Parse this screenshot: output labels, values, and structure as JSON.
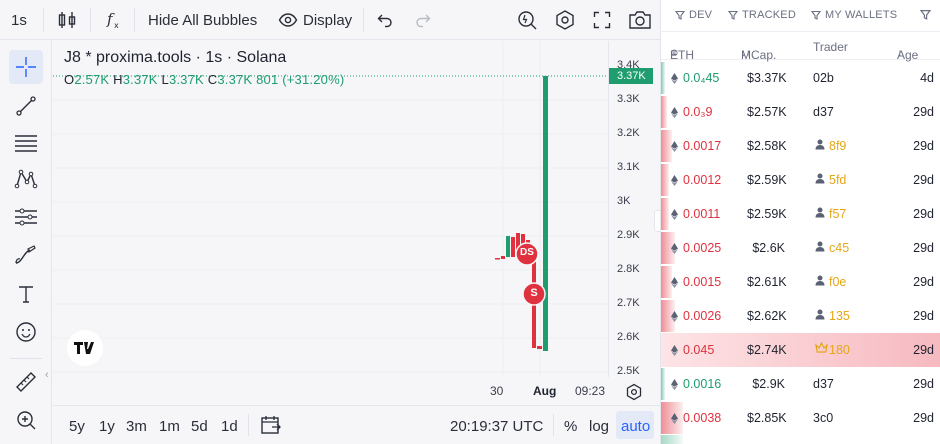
{
  "toolbar": {
    "interval": "1s",
    "hide_bubbles": "Hide All Bubbles",
    "display": "Display"
  },
  "legend": {
    "title": "J8 * proxima.tools · 1s · Solana",
    "o_label": "O",
    "o_value": "2.57K",
    "h_label": "H",
    "h_value": "3.37K",
    "l_label": "L",
    "l_value": "3.37K",
    "c_label": "C",
    "c_value": "3.37K",
    "change": "801 (+31.20%)"
  },
  "price_axis": {
    "ticks": [
      "3.4K",
      "3.3K",
      "3.2K",
      "3.1K",
      "3K",
      "2.9K",
      "2.8K",
      "2.7K",
      "2.6K",
      "2.5K"
    ],
    "last_price": "3.37K"
  },
  "time_axis": {
    "ticks": [
      "30",
      "Aug",
      "09:23"
    ]
  },
  "markers": {
    "ds": "DS",
    "s": "S"
  },
  "bottombar": {
    "ranges": [
      "5y",
      "1y",
      "3m",
      "1m",
      "5d",
      "1d"
    ],
    "clock": "20:19:37 UTC",
    "percent": "%",
    "log": "log",
    "auto": "auto"
  },
  "panel": {
    "tabs": {
      "dev": "DEV",
      "tracked": "TRACKED",
      "wallets": "MY WALLETS"
    },
    "headers": {
      "eth": "ETH",
      "mcap": "MCap.",
      "trader": "Trader",
      "age": "Age"
    },
    "rows": [
      {
        "amount": "0.0₄45",
        "mcap": "$3.37K",
        "trader": "02b",
        "age": "4d",
        "side": "buy",
        "bar": 0.01,
        "tracked": false,
        "crown": false
      },
      {
        "amount": "0.0₃9",
        "mcap": "$2.57K",
        "trader": "d37",
        "age": "29d",
        "side": "sell",
        "bar": 0.02,
        "tracked": false,
        "crown": false
      },
      {
        "amount": "0.0017",
        "mcap": "$2.58K",
        "trader": "8f9",
        "age": "29d",
        "side": "sell",
        "bar": 0.04,
        "tracked": true,
        "crown": false
      },
      {
        "amount": "0.0012",
        "mcap": "$2.59K",
        "trader": "5fd",
        "age": "29d",
        "side": "sell",
        "bar": 0.03,
        "tracked": true,
        "crown": false
      },
      {
        "amount": "0.0011",
        "mcap": "$2.59K",
        "trader": "f57",
        "age": "29d",
        "side": "sell",
        "bar": 0.03,
        "tracked": true,
        "crown": false
      },
      {
        "amount": "0.0025",
        "mcap": "$2.6K",
        "trader": "c45",
        "age": "29d",
        "side": "sell",
        "bar": 0.05,
        "tracked": true,
        "crown": false
      },
      {
        "amount": "0.0015",
        "mcap": "$2.61K",
        "trader": "f0e",
        "age": "29d",
        "side": "sell",
        "bar": 0.04,
        "tracked": true,
        "crown": false
      },
      {
        "amount": "0.0026",
        "mcap": "$2.62K",
        "trader": "135",
        "age": "29d",
        "side": "sell",
        "bar": 0.05,
        "tracked": true,
        "crown": false
      },
      {
        "amount": "0.045",
        "mcap": "$2.74K",
        "trader": "180",
        "age": "29d",
        "side": "sell",
        "bar": 1.0,
        "tracked": false,
        "crown": true
      },
      {
        "amount": "0.0016",
        "mcap": "$2.9K",
        "trader": "d37",
        "age": "29d",
        "side": "buy",
        "bar": 0.01,
        "tracked": false,
        "crown": false
      },
      {
        "amount": "0.0038",
        "mcap": "$2.85K",
        "trader": "3c0",
        "age": "29d",
        "side": "sell",
        "bar": 0.08,
        "tracked": false,
        "crown": false
      }
    ]
  },
  "colors": {
    "up": "#1f9d6e",
    "down": "#e0313f",
    "accent": "#2962ff",
    "tracked": "#e6a617"
  }
}
